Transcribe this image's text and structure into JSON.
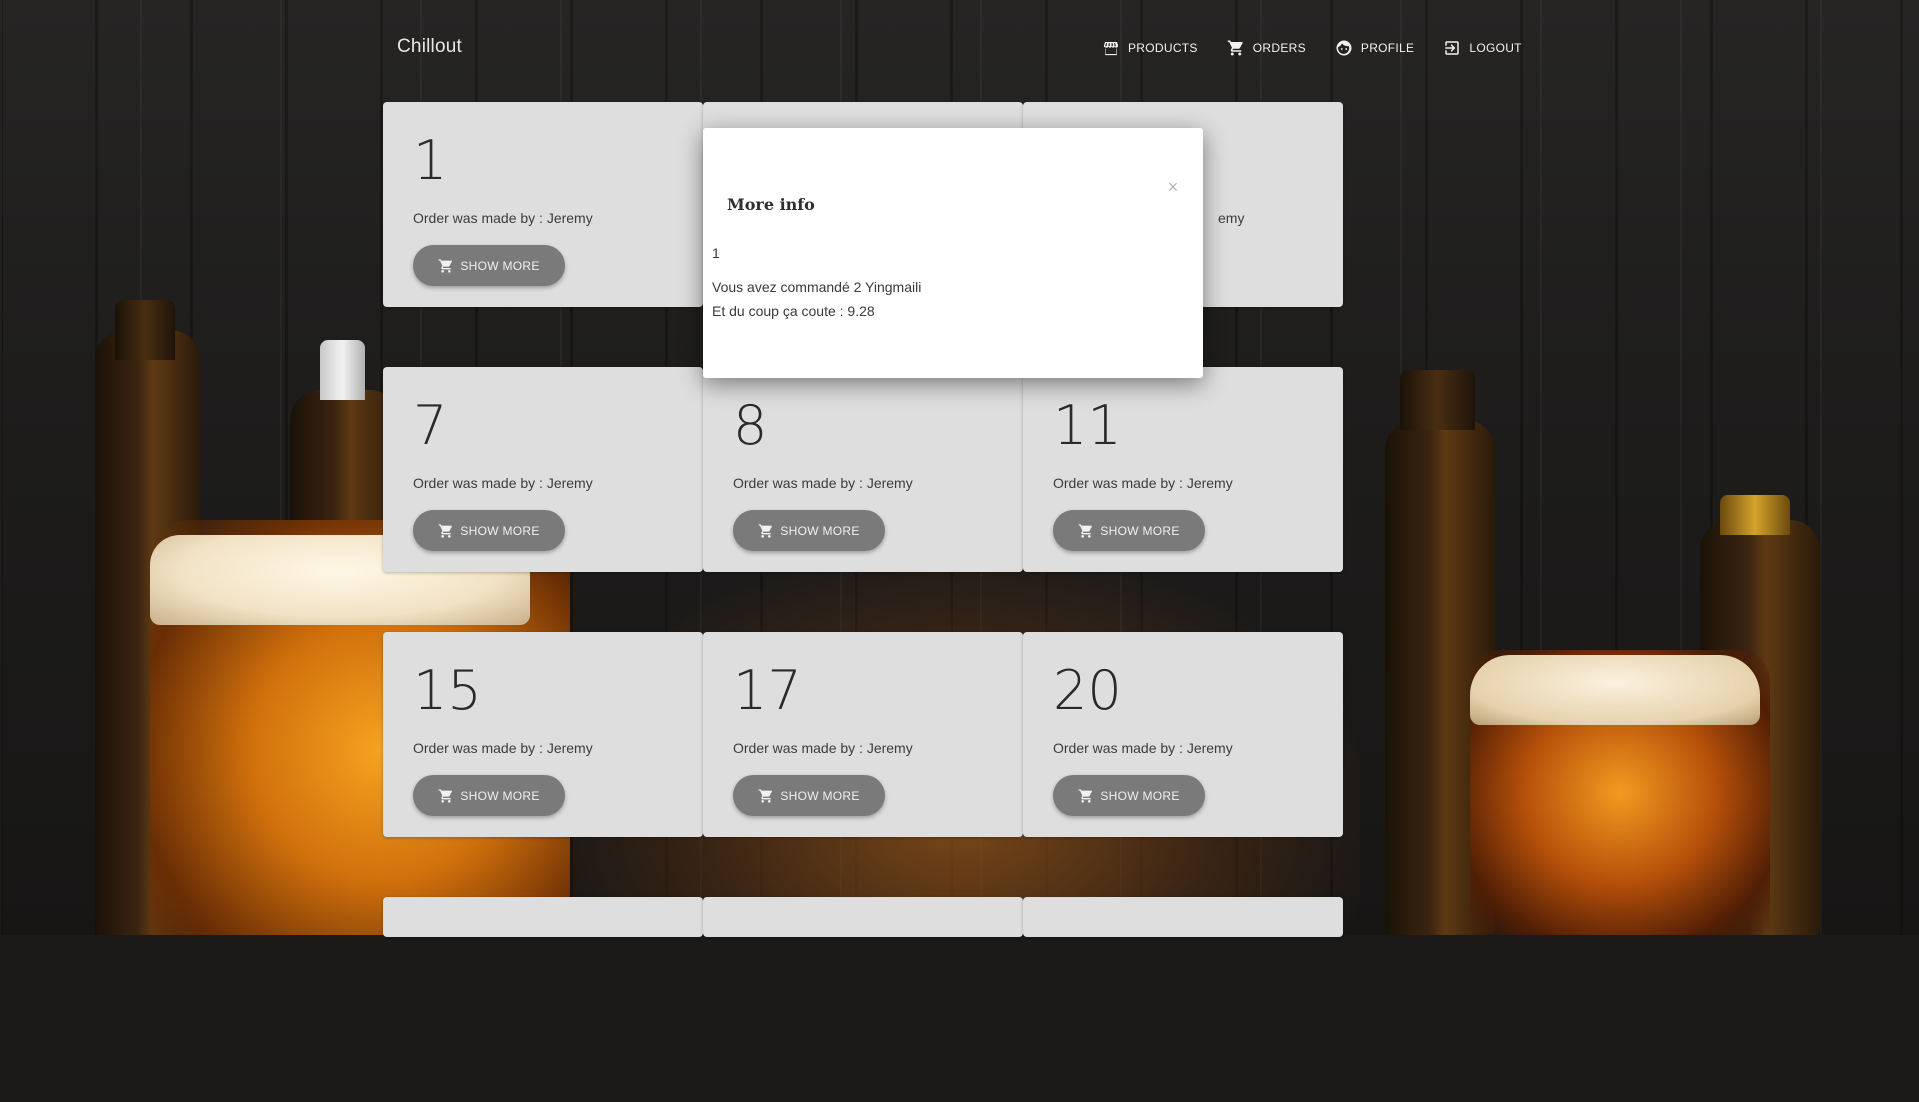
{
  "app": {
    "brand": "Chillout"
  },
  "nav": {
    "items": [
      {
        "label": "PRODUCTS",
        "icon": "storefront-icon"
      },
      {
        "label": "ORDERS",
        "icon": "cart-icon"
      },
      {
        "label": "PROFILE",
        "icon": "face-icon"
      },
      {
        "label": "LOGOUT",
        "icon": "logout-icon"
      }
    ]
  },
  "orders": [
    {
      "number": "1",
      "made_by": "Order was made by : Jeremy",
      "button": "SHOW MORE"
    },
    {
      "number": "",
      "made_by": "",
      "button": ""
    },
    {
      "number": "",
      "made_by": "emy",
      "button": ""
    },
    {
      "number": "7",
      "made_by": "Order was made by : Jeremy",
      "button": "SHOW MORE"
    },
    {
      "number": "8",
      "made_by": "Order was made by : Jeremy",
      "button": "SHOW MORE"
    },
    {
      "number": "11",
      "made_by": "Order was made by : Jeremy",
      "button": "SHOW MORE"
    },
    {
      "number": "15",
      "made_by": "Order was made by : Jeremy",
      "button": "SHOW MORE"
    },
    {
      "number": "17",
      "made_by": "Order was made by : Jeremy",
      "button": "SHOW MORE"
    },
    {
      "number": "20",
      "made_by": "Order was made by : Jeremy",
      "button": "SHOW MORE"
    }
  ],
  "modal": {
    "title": "More info",
    "close": "×",
    "order_id": "1",
    "line1": "Vous avez commandé 2 Yingmaili",
    "line2": "Et du coup ça coute : 9.28"
  }
}
